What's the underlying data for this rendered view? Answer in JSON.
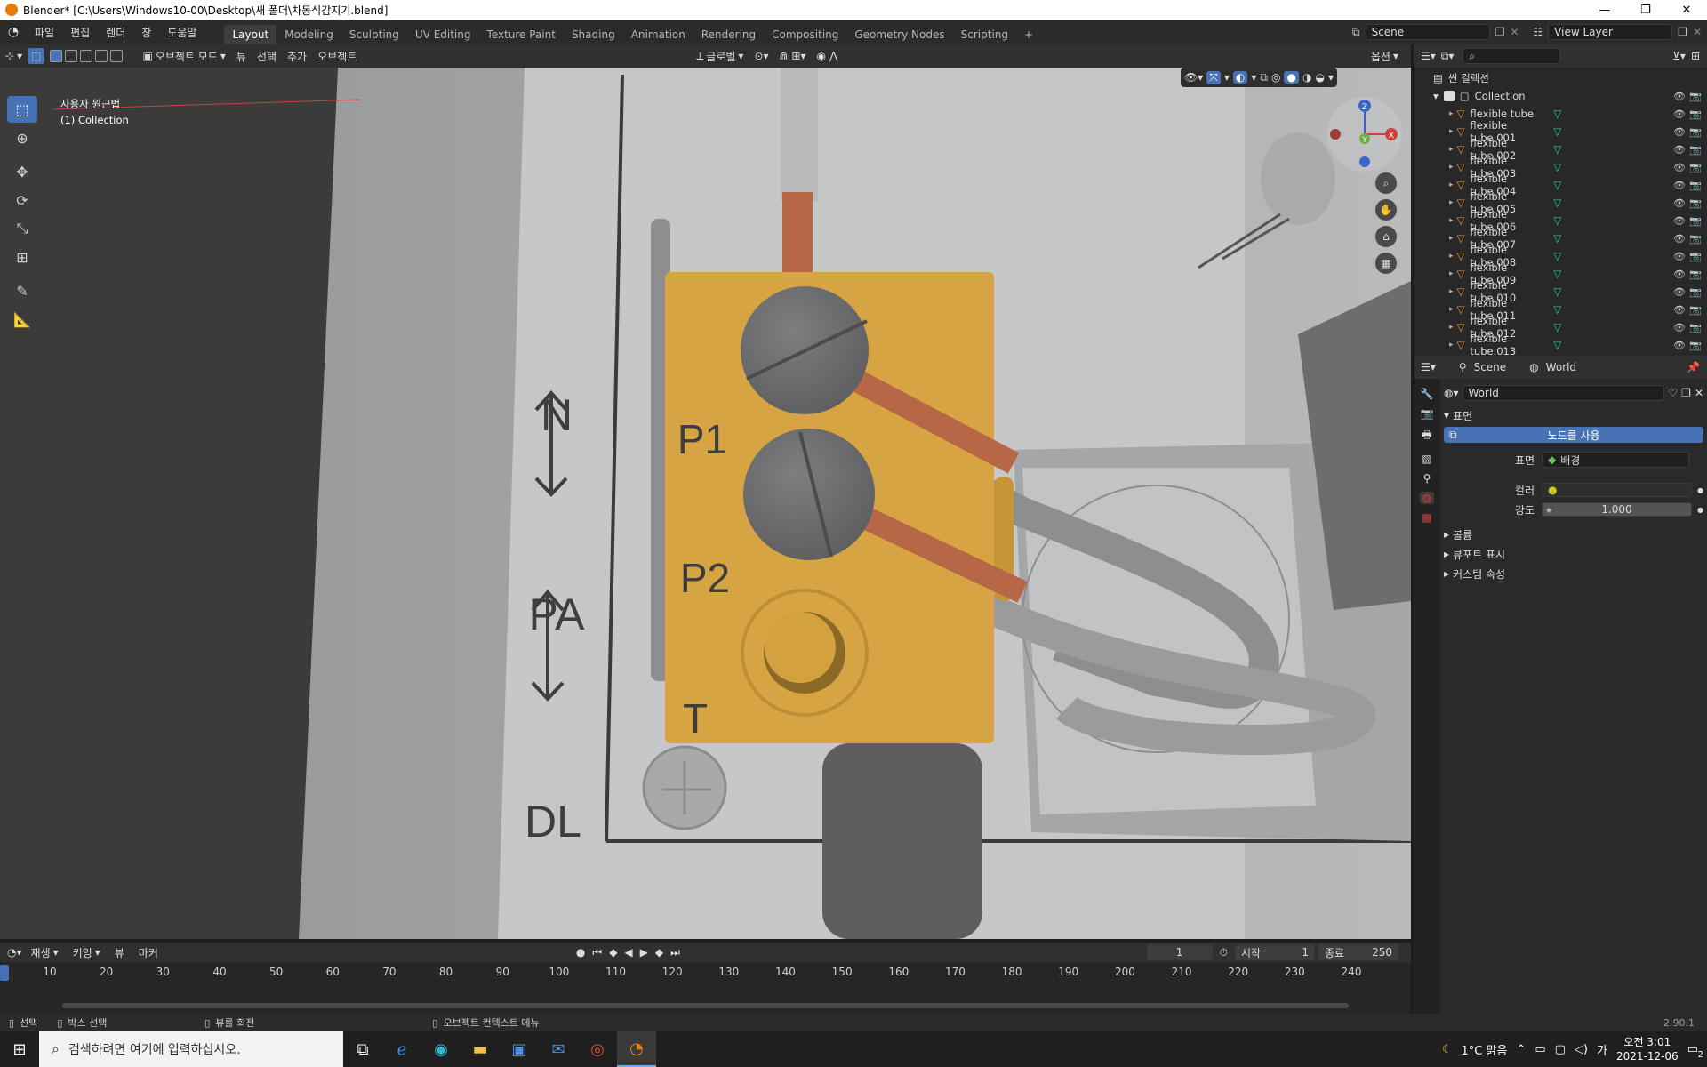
{
  "window": {
    "title": "Blender* [C:\\Users\\Windows10-00\\Desktop\\새 폴더\\차동식감지기.blend]",
    "minimize": "—",
    "maximize": "❐",
    "close": "✕"
  },
  "menus": [
    "파일",
    "편집",
    "렌더",
    "창",
    "도움말"
  ],
  "workspaces": [
    "Layout",
    "Modeling",
    "Sculpting",
    "UV Editing",
    "Texture Paint",
    "Shading",
    "Animation",
    "Rendering",
    "Compositing",
    "Geometry Nodes",
    "Scripting"
  ],
  "add_workspace": "+",
  "scene": {
    "name": "Scene"
  },
  "view_layer": {
    "name": "View Layer"
  },
  "viewport_header": {
    "mode": "오브젝트 모드",
    "view": "뷰",
    "select": "선택",
    "add": "추가",
    "object": "오브젝트",
    "orientation": "글로벌",
    "options": "옵션"
  },
  "viewport_overlay": {
    "view_name": "사용자 원근법",
    "collection": "(1) Collection"
  },
  "model_labels": {
    "n": "N",
    "pa": "PA",
    "dl": "DL",
    "p1": "P1",
    "p2": "P2",
    "t": "T"
  },
  "gizmo": {
    "z": "Z",
    "y": "Y",
    "x": "X"
  },
  "outliner": {
    "root": "씬 컬렉션",
    "collection": "Collection",
    "items": [
      "flexible tube",
      "flexible tube.001",
      "flexible tube.002",
      "flexible tube.003",
      "flexible tube.004",
      "flexible tube.005",
      "flexible tube.006",
      "flexible tube.007",
      "flexible tube.008",
      "flexible tube.009",
      "flexible tube.010",
      "flexible tube.011",
      "flexible tube.012",
      "flexible tube.013"
    ]
  },
  "properties": {
    "tab_scene": "Scene",
    "tab_world": "World",
    "world_name": "World",
    "surface_panel": "표면",
    "use_nodes": "노드를 사용",
    "surface_label": "표면",
    "surface_value": "배경",
    "color_label": "컬러",
    "strength_label": "강도",
    "strength_value": "1.000",
    "volume_panel": "볼륨",
    "viewport_display_panel": "뷰포트 표시",
    "custom_props_panel": "커스텀 속성"
  },
  "timeline": {
    "playback": "재생",
    "keying": "키잉",
    "view": "뷰",
    "marker": "마커",
    "current_frame": "1",
    "start_label": "시작",
    "start": "1",
    "end_label": "종료",
    "end": "250",
    "ticks": [
      "10",
      "20",
      "30",
      "40",
      "50",
      "60",
      "70",
      "80",
      "90",
      "100",
      "110",
      "120",
      "130",
      "140",
      "150",
      "160",
      "170",
      "180",
      "190",
      "200",
      "210",
      "220",
      "230",
      "240"
    ]
  },
  "statusbar": {
    "select": "선택",
    "box_select": "박스 선택",
    "rotate_view": "뷰를 회전",
    "context_menu": "오브젝트 컨텍스트 메뉴",
    "version": "2.90.1"
  },
  "taskbar": {
    "search_placeholder": "검색하려면 여기에 입력하십시오.",
    "weather": "1°C 맑음",
    "time": "오전 3:01",
    "date": "2021-12-06",
    "ime": "가",
    "notifications": "2"
  }
}
